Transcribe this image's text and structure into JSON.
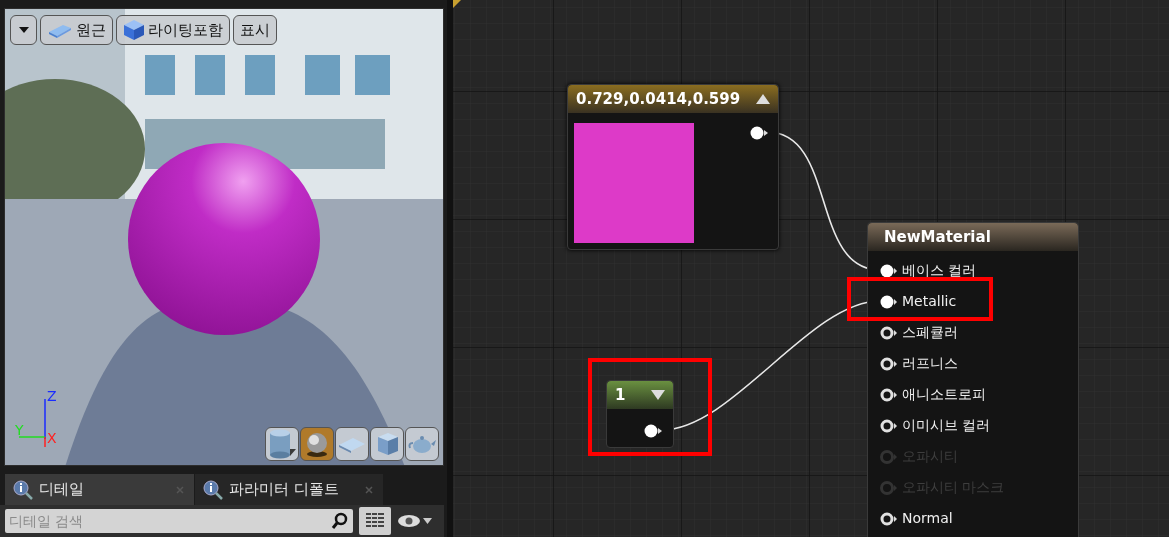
{
  "viewport": {
    "toolbar": [
      {
        "kind": "menu"
      },
      {
        "kind": "perspective",
        "label": "원근"
      },
      {
        "kind": "lit",
        "label": "라이팅포함"
      },
      {
        "kind": "plain",
        "label": "표시"
      }
    ],
    "axes": [
      {
        "label": "Z"
      },
      {
        "label": "Y"
      },
      {
        "label": "X"
      }
    ],
    "preview_shapes": [
      {
        "kind": "cylinder",
        "selected": false
      },
      {
        "kind": "sphere",
        "selected": true
      },
      {
        "kind": "plane",
        "selected": false
      },
      {
        "kind": "cube",
        "selected": false
      },
      {
        "kind": "teapot",
        "selected": false
      }
    ]
  },
  "panel_tabs": [
    {
      "label": "디테일",
      "selected": true
    },
    {
      "label": "파라미터 디폴트",
      "selected": false
    }
  ],
  "search": {
    "placeholder": "디테일 검색"
  },
  "graph": {
    "color_node": {
      "title": "0.729,0.0414,0.599",
      "color": "#dd3ac8"
    },
    "constant_node": {
      "title": "1",
      "highlighted": true
    },
    "material_node": {
      "title": "NewMaterial",
      "pins": [
        {
          "label": "베이스 컬러",
          "connected": true,
          "disabled": false,
          "highlighted": false
        },
        {
          "label": "Metallic",
          "connected": true,
          "disabled": false,
          "highlighted": true
        },
        {
          "label": "스페큘러",
          "connected": false,
          "disabled": false,
          "highlighted": false
        },
        {
          "label": "러프니스",
          "connected": false,
          "disabled": false,
          "highlighted": false
        },
        {
          "label": "애니소트로피",
          "connected": false,
          "disabled": false,
          "highlighted": false
        },
        {
          "label": "이미시브 컬러",
          "connected": false,
          "disabled": false,
          "highlighted": false
        },
        {
          "label": "오파시티",
          "connected": false,
          "disabled": true,
          "highlighted": false
        },
        {
          "label": "오파시티 마스크",
          "connected": false,
          "disabled": true,
          "highlighted": false
        },
        {
          "label": "Normal",
          "connected": false,
          "disabled": false,
          "highlighted": false
        }
      ]
    }
  }
}
